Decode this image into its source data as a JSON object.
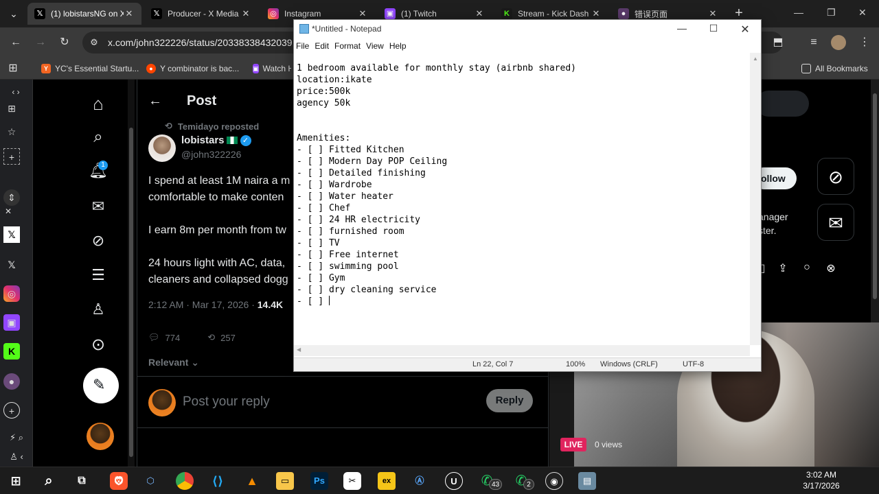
{
  "browser": {
    "tabs": [
      {
        "title": "(1) lobistarsNG on X",
        "icon": "x-icon",
        "active": true
      },
      {
        "title": "Producer - X Media",
        "icon": "x-icon",
        "active": false
      },
      {
        "title": "Instagram",
        "icon": "instagram-icon",
        "active": false
      },
      {
        "title": "(1) Twitch",
        "icon": "twitch-icon",
        "active": false
      },
      {
        "title": "Stream - Kick Dash",
        "icon": "kick-icon",
        "active": false
      },
      {
        "title": "错误页面",
        "icon": "error-page-icon",
        "active": false
      }
    ],
    "url": "x.com/john322226/status/20338338432039",
    "bookmarks": [
      {
        "label": "YC's Essential Startu...",
        "icon": "yc-icon"
      },
      {
        "label": "Y combinator is bac...",
        "icon": "reddit-icon"
      },
      {
        "label": "Watch H",
        "icon": "twitch-icon"
      }
    ],
    "all_bookmarks": "All Bookmarks"
  },
  "x": {
    "header": "Post",
    "repost_note": "Temidayo reposted",
    "display_name": "lobistars",
    "handle": "@john322226",
    "tweet_lines": [
      "I spend at least 1M naira a m",
      "comfortable to make conten",
      "I earn 8m per month from tw",
      "24 hours light with AC, data,",
      "cleaners and collapsed dogg"
    ],
    "meta_time": "2:12 AM · Mar 17, 2026 · ",
    "meta_views": "14.4K",
    "replies": "774",
    "reposts": "257",
    "sort_label": "Relevant",
    "reply_placeholder": "Post your reply",
    "reply_button": "Reply",
    "notif_count": "1",
    "follow_button": "ollow",
    "side_text_1": "anager",
    "side_text_2": "ster."
  },
  "notepad": {
    "title": "*Untitled - Notepad",
    "menu": [
      "File",
      "Edit",
      "Format",
      "View",
      "Help"
    ],
    "lines": [
      "1 bedroom available for monthly stay (airbnb shared)",
      "location:ikate",
      "price:500k",
      "agency 50k",
      "",
      "",
      "Amenities:",
      "- [ ] Fitted Kitchen",
      "- [ ] Modern Day POP Ceiling",
      "- [ ] Detailed finishing",
      "- [ ] Wardrobe",
      "- [ ] Water heater",
      "- [ ] Chef",
      "- [ ] 24 HR electricity",
      "- [ ] furnished room",
      "- [ ] TV",
      "- [ ] Free internet",
      "- [ ] swimming pool",
      "- [ ] Gym",
      "- [ ] dry cleaning service",
      "- [ ] "
    ],
    "status_pos": "Ln 22, Col 7",
    "status_zoom": "100%",
    "status_eol": "Windows (CRLF)",
    "status_enc": "UTF-8"
  },
  "stream": {
    "live": "LIVE",
    "views": "0 views"
  },
  "taskbar": {
    "whatsapp_badge_1": "43",
    "whatsapp_badge_2": "2",
    "time": "3:02 AM",
    "date": "3/17/2026"
  },
  "colors": {
    "x_bg": "#000000",
    "x_text": "#e7e9ea",
    "x_muted": "#71767b",
    "verified": "#1d9bf0",
    "live_red": "#e0245e"
  }
}
